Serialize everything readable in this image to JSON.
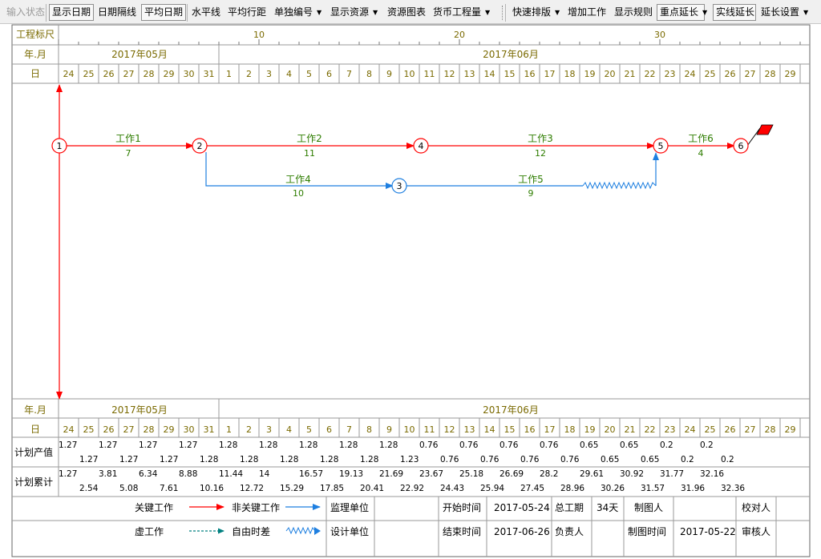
{
  "toolbar": {
    "items": [
      {
        "label": "输入状态",
        "state": "disabled",
        "dropdown": false
      },
      {
        "label": "显示日期",
        "state": "pressed",
        "dropdown": false
      },
      {
        "label": "日期隔线",
        "state": "normal",
        "dropdown": false
      },
      {
        "label": "平均日期",
        "state": "pressed",
        "dropdown": false
      },
      {
        "label": "水平线",
        "state": "normal",
        "dropdown": false
      },
      {
        "label": "平均行距",
        "state": "normal",
        "dropdown": false
      },
      {
        "label": "单独编号",
        "state": "normal",
        "dropdown": true
      },
      {
        "label": "显示资源",
        "state": "normal",
        "dropdown": true
      },
      {
        "label": "资源图表",
        "state": "normal",
        "dropdown": false
      },
      {
        "label": "货币工程量",
        "state": "normal",
        "dropdown": true
      },
      {
        "label": "快速排版",
        "state": "normal",
        "dropdown": true
      },
      {
        "label": "增加工作",
        "state": "normal",
        "dropdown": false
      },
      {
        "label": "显示规则",
        "state": "normal",
        "dropdown": false
      },
      {
        "label": "重点延长",
        "state": "pressed",
        "dropdown": true
      },
      {
        "label": "实线延长",
        "state": "pressed",
        "dropdown": false
      },
      {
        "label": "延长设置",
        "state": "normal",
        "dropdown": true
      }
    ]
  },
  "header": {
    "ruler_label": "工程标尺",
    "month_row_label": "年.月",
    "day_row_label": "日",
    "ruler_ticks": [
      "10",
      "20",
      "30"
    ],
    "months": [
      "2017年05月",
      "2017年06月"
    ],
    "days": [
      "24",
      "25",
      "26",
      "27",
      "28",
      "29",
      "30",
      "31",
      "1",
      "2",
      "3",
      "4",
      "5",
      "6",
      "7",
      "8",
      "9",
      "10",
      "11",
      "12",
      "13",
      "14",
      "15",
      "16",
      "17",
      "18",
      "19",
      "20",
      "21",
      "22",
      "23",
      "24",
      "25",
      "26",
      "27",
      "28",
      "29"
    ]
  },
  "network": {
    "nodes": [
      {
        "id": "1",
        "critical": true
      },
      {
        "id": "2",
        "critical": true
      },
      {
        "id": "3",
        "critical": false
      },
      {
        "id": "4",
        "critical": true
      },
      {
        "id": "5",
        "critical": true
      },
      {
        "id": "6",
        "critical": true
      }
    ],
    "works": [
      {
        "name": "工作1",
        "duration": "7",
        "from": "1",
        "to": "2",
        "critical": true
      },
      {
        "name": "工作2",
        "duration": "11",
        "from": "2",
        "to": "4",
        "critical": true
      },
      {
        "name": "工作3",
        "duration": "12",
        "from": "4",
        "to": "5",
        "critical": true
      },
      {
        "name": "工作6",
        "duration": "4",
        "from": "5",
        "to": "6",
        "critical": true
      },
      {
        "name": "工作4",
        "duration": "10",
        "from": "2",
        "to": "3",
        "critical": false
      },
      {
        "name": "工作5",
        "duration": "9",
        "from": "3",
        "to": "5",
        "critical": false,
        "free_float": true
      }
    ]
  },
  "output_rows": {
    "plan_output_label": "计划产值",
    "plan_output_top": [
      "1.27",
      "1.27",
      "1.27",
      "1.27",
      "1.28",
      "1.28",
      "1.28",
      "1.28",
      "1.28",
      "0.76",
      "0.76",
      "0.76",
      "0.76",
      "0.65",
      "0.65",
      "0.2",
      "0.2"
    ],
    "plan_output_bottom": [
      "1.27",
      "1.27",
      "1.27",
      "1.28",
      "1.28",
      "1.28",
      "1.28",
      "1.28",
      "1.23",
      "0.76",
      "0.76",
      "0.76",
      "0.76",
      "0.65",
      "0.65",
      "0.2",
      "0.2"
    ],
    "plan_cumulative_label": "计划累计",
    "plan_cumulative_top": [
      "1.27",
      "3.81",
      "6.34",
      "8.88",
      "11.44",
      "14",
      "16.57",
      "19.13",
      "21.69",
      "23.67",
      "25.18",
      "26.69",
      "28.2",
      "29.61",
      "30.92",
      "31.77",
      "32.16"
    ],
    "plan_cumulative_bottom": [
      "2.54",
      "5.08",
      "7.61",
      "10.16",
      "12.72",
      "15.29",
      "17.85",
      "20.41",
      "22.92",
      "24.43",
      "25.94",
      "27.45",
      "28.96",
      "30.26",
      "31.57",
      "31.96",
      "32.36"
    ]
  },
  "legend": {
    "critical_work": "关键工作",
    "noncritical_work": "非关键工作",
    "dummy_work": "虚工作",
    "free_float": "自由时差",
    "supervisor_unit": "监理单位",
    "design_unit": "设计单位",
    "start_time_label": "开始时间",
    "start_time": "2017-05-24",
    "end_time_label": "结束时间",
    "end_time": "2017-06-26",
    "total_duration_label": "总工期",
    "total_duration": "34天",
    "responsible_label": "负责人",
    "drafter_label": "制图人",
    "draw_time_label": "制图时间",
    "draw_time": "2017-05-22",
    "proofreader_label": "校对人",
    "reviewer_label": "审核人"
  },
  "colors": {
    "critical": "#ff0000",
    "noncritical": "#1e7fe0",
    "label_olive": "#7a6a00",
    "label_green": "#2e7d00",
    "grid": "#9a9a9a",
    "dummy": "#008080"
  }
}
